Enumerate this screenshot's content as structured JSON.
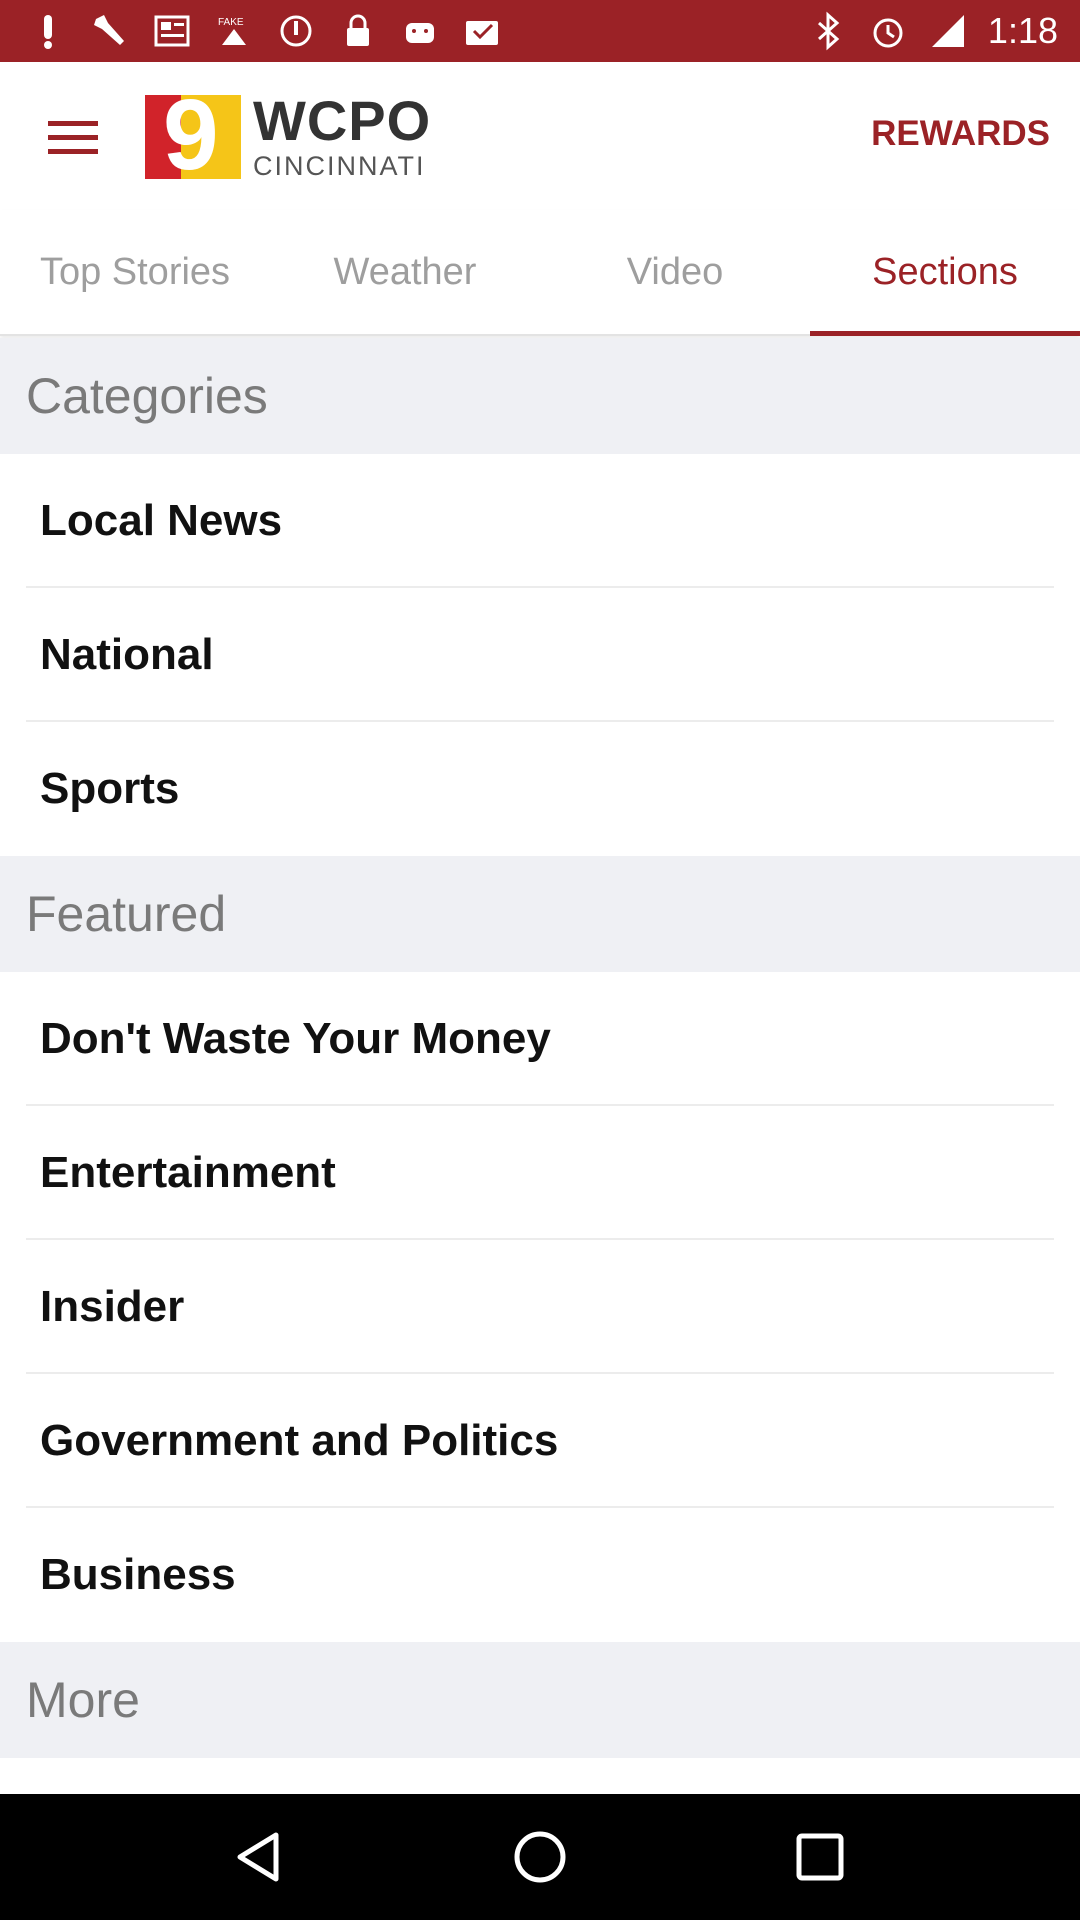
{
  "status_bar": {
    "time": "1:18",
    "left_icons": [
      "notification-icon",
      "wrench-icon",
      "news-icon",
      "fake-gps-icon",
      "blocked-icon",
      "lock-icon",
      "android-icon",
      "checklist-icon"
    ],
    "right_icons": [
      "bluetooth-icon",
      "alarm-icon",
      "signal-icon"
    ]
  },
  "app_bar": {
    "logo_number": "9",
    "logo_name": "WCPO",
    "logo_city": "CINCINNATI",
    "rewards_label": "REWARDS"
  },
  "tabs": [
    {
      "label": "Top Stories",
      "active": false
    },
    {
      "label": "Weather",
      "active": false
    },
    {
      "label": "Video",
      "active": false
    },
    {
      "label": "Sections",
      "active": true
    }
  ],
  "sections": [
    {
      "header": "Categories",
      "items": [
        "Local News",
        "National",
        "Sports"
      ]
    },
    {
      "header": "Featured",
      "items": [
        "Don't Waste Your Money",
        "Entertainment",
        "Insider",
        "Government and Politics",
        "Business"
      ]
    },
    {
      "header": "More",
      "items": []
    }
  ],
  "colors": {
    "brand_red": "#9b2226",
    "section_bg": "#eff0f4"
  }
}
